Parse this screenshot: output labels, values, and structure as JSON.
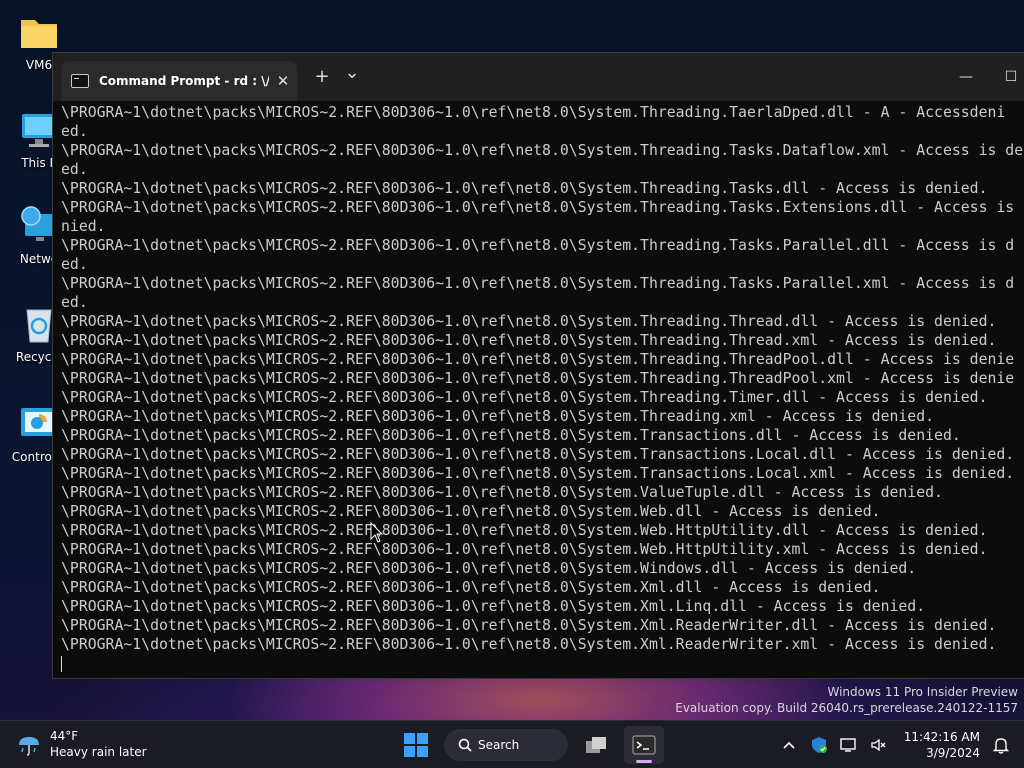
{
  "desktop": {
    "icons": [
      {
        "label": "VM6",
        "icon": "folder-icon"
      },
      {
        "label": "This P",
        "icon": "this-pc-icon"
      },
      {
        "label": "Netwo",
        "icon": "network-icon"
      },
      {
        "label": "Recycle",
        "icon": "recycle-bin-icon"
      },
      {
        "label": "Control P",
        "icon": "control-panel-icon"
      }
    ]
  },
  "window": {
    "tab_title": "Command Prompt - rd  : \\/s /",
    "tab_close": "✕",
    "new_tab": "+",
    "dropdown": "⌄",
    "minimize": "—",
    "maximize": "☐"
  },
  "terminal": {
    "lines": [
      "\\PROGRA~1\\dotnet\\packs\\MICROS~2.REF\\80D306~1.0\\ref\\net8.0\\System.Threading.TaerlaDped.dll - A - Accessdeni",
      "ed.",
      "\\PROGRA~1\\dotnet\\packs\\MICROS~2.REF\\80D306~1.0\\ref\\net8.0\\System.Threading.Tasks.Dataflow.xml - Access is de",
      "ed.",
      "\\PROGRA~1\\dotnet\\packs\\MICROS~2.REF\\80D306~1.0\\ref\\net8.0\\System.Threading.Tasks.dll - Access is denied.",
      "\\PROGRA~1\\dotnet\\packs\\MICROS~2.REF\\80D306~1.0\\ref\\net8.0\\System.Threading.Tasks.Extensions.dll - Access is",
      "nied.",
      "\\PROGRA~1\\dotnet\\packs\\MICROS~2.REF\\80D306~1.0\\ref\\net8.0\\System.Threading.Tasks.Parallel.dll - Access is d",
      "ed.",
      "\\PROGRA~1\\dotnet\\packs\\MICROS~2.REF\\80D306~1.0\\ref\\net8.0\\System.Threading.Tasks.Parallel.xml - Access is d",
      "ed.",
      "\\PROGRA~1\\dotnet\\packs\\MICROS~2.REF\\80D306~1.0\\ref\\net8.0\\System.Threading.Thread.dll - Access is denied.",
      "\\PROGRA~1\\dotnet\\packs\\MICROS~2.REF\\80D306~1.0\\ref\\net8.0\\System.Threading.Thread.xml - Access is denied.",
      "\\PROGRA~1\\dotnet\\packs\\MICROS~2.REF\\80D306~1.0\\ref\\net8.0\\System.Threading.ThreadPool.dll - Access is denie",
      "\\PROGRA~1\\dotnet\\packs\\MICROS~2.REF\\80D306~1.0\\ref\\net8.0\\System.Threading.ThreadPool.xml - Access is denie",
      "\\PROGRA~1\\dotnet\\packs\\MICROS~2.REF\\80D306~1.0\\ref\\net8.0\\System.Threading.Timer.dll - Access is denied.",
      "\\PROGRA~1\\dotnet\\packs\\MICROS~2.REF\\80D306~1.0\\ref\\net8.0\\System.Threading.xml - Access is denied.",
      "\\PROGRA~1\\dotnet\\packs\\MICROS~2.REF\\80D306~1.0\\ref\\net8.0\\System.Transactions.dll - Access is denied.",
      "\\PROGRA~1\\dotnet\\packs\\MICROS~2.REF\\80D306~1.0\\ref\\net8.0\\System.Transactions.Local.dll - Access is denied.",
      "\\PROGRA~1\\dotnet\\packs\\MICROS~2.REF\\80D306~1.0\\ref\\net8.0\\System.Transactions.Local.xml - Access is denied.",
      "\\PROGRA~1\\dotnet\\packs\\MICROS~2.REF\\80D306~1.0\\ref\\net8.0\\System.ValueTuple.dll - Access is denied.",
      "\\PROGRA~1\\dotnet\\packs\\MICROS~2.REF\\80D306~1.0\\ref\\net8.0\\System.Web.dll - Access is denied.",
      "\\PROGRA~1\\dotnet\\packs\\MICROS~2.REF\\80D306~1.0\\ref\\net8.0\\System.Web.HttpUtility.dll - Access is denied.",
      "\\PROGRA~1\\dotnet\\packs\\MICROS~2.REF\\80D306~1.0\\ref\\net8.0\\System.Web.HttpUtility.xml - Access is denied.",
      "\\PROGRA~1\\dotnet\\packs\\MICROS~2.REF\\80D306~1.0\\ref\\net8.0\\System.Windows.dll - Access is denied.",
      "\\PROGRA~1\\dotnet\\packs\\MICROS~2.REF\\80D306~1.0\\ref\\net8.0\\System.Xml.dll - Access is denied.",
      "\\PROGRA~1\\dotnet\\packs\\MICROS~2.REF\\80D306~1.0\\ref\\net8.0\\System.Xml.Linq.dll - Access is denied.",
      "\\PROGRA~1\\dotnet\\packs\\MICROS~2.REF\\80D306~1.0\\ref\\net8.0\\System.Xml.ReaderWriter.dll - Access is denied.",
      "\\PROGRA~1\\dotnet\\packs\\MICROS~2.REF\\80D306~1.0\\ref\\net8.0\\System.Xml.ReaderWriter.xml - Access is denied."
    ]
  },
  "watermark": {
    "line1": "Windows 11 Pro Insider Preview",
    "line2": "Evaluation copy. Build 26040.rs_prerelease.240122-1157"
  },
  "taskbar": {
    "weather_temp": "44°F",
    "weather_desc": "Heavy rain later",
    "search_label": "Search",
    "time": "11:42:16 AM",
    "date": "3/9/2024",
    "accent": "#d9a7f5"
  }
}
